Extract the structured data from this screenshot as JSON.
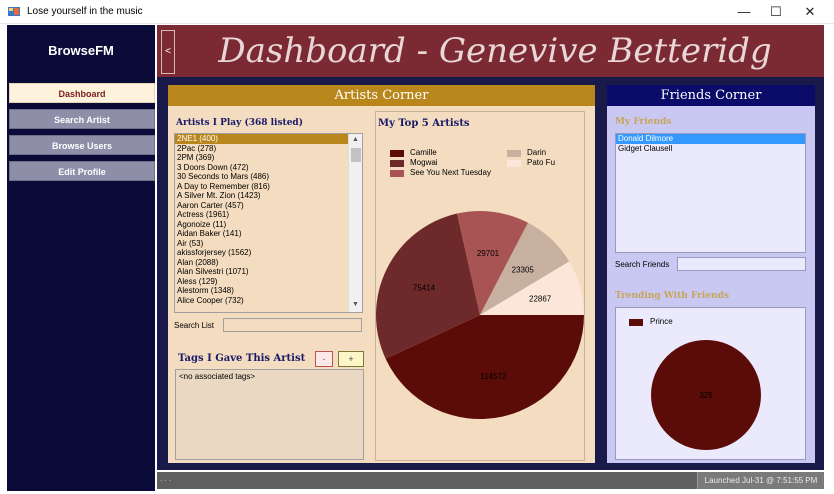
{
  "window": {
    "title": "Lose yourself in the music",
    "minimize": "—",
    "maximize": "☐",
    "close": "✕"
  },
  "sidebar": {
    "brand": "BrowseFM",
    "items": [
      {
        "label": "Dashboard",
        "active": true
      },
      {
        "label": "Search Artist",
        "active": false
      },
      {
        "label": "Browse Users",
        "active": false
      },
      {
        "label": "Edit Profile",
        "active": false
      }
    ]
  },
  "header": {
    "collapse_label": "<",
    "title": "Dashboard - Genevive Betteridg"
  },
  "artists_corner": {
    "heading": "Artists Corner",
    "list_label": "Artists I Play (368 listed)",
    "artists": [
      "2NE1 (400)",
      "2Pac (278)",
      "2PM (369)",
      "3 Doors Down (472)",
      "30 Seconds to Mars (486)",
      "A Day to Remember (816)",
      "A Silver Mt. Zion (1423)",
      "Aaron Carter (457)",
      "Actress (1961)",
      "Agonoize (11)",
      "Aidan Baker (141)",
      "Air (53)",
      "akissforjersey (1562)",
      "Alan (2088)",
      "Alan Silvestri (1071)",
      "Aless (129)",
      "Alestorm (1348)",
      "Alice Cooper (732)"
    ],
    "selected_artist": "2NE1 (400)",
    "search_label": "Search List",
    "search_value": "",
    "tags_label": "Tags I Gave This Artist",
    "tag_remove": "-",
    "tag_add": "+",
    "tags_text": "<no associated tags>",
    "top5_label": "My Top 5 Artists"
  },
  "friends_corner": {
    "heading": "Friends Corner",
    "my_friends_label": "My Friends",
    "friends": [
      "Donald Dilmore",
      "Gidget Clausell"
    ],
    "selected_friend": "Donald Dilmore",
    "search_label": "Search Friends",
    "search_value": "",
    "trending_label": "Trending With Friends"
  },
  "status": {
    "left": ". . .",
    "right": "Launched Jul-31 @ 7:51:55 PM"
  },
  "colors": {
    "camille": "#5c0c08",
    "mogwai": "#6e2a2a",
    "see_you": "#a85454",
    "darin": "#c7b0a0",
    "pato_fu": "#fbe6d9",
    "prince": "#5c0c08"
  },
  "chart_data": [
    {
      "type": "pie",
      "title": "My Top 5 Artists",
      "series": [
        {
          "values": [
            114572,
            75414,
            29701,
            23305,
            22867
          ],
          "labels": [
            "Camille",
            "Mogwai",
            "See You Next Tuesday",
            "Darin",
            "Pato Fu"
          ]
        }
      ],
      "legend": "top"
    },
    {
      "type": "pie",
      "title": "Trending With Friends",
      "series": [
        {
          "values": [
            325
          ],
          "labels": [
            "Prince"
          ]
        }
      ],
      "legend": "top-left"
    }
  ]
}
